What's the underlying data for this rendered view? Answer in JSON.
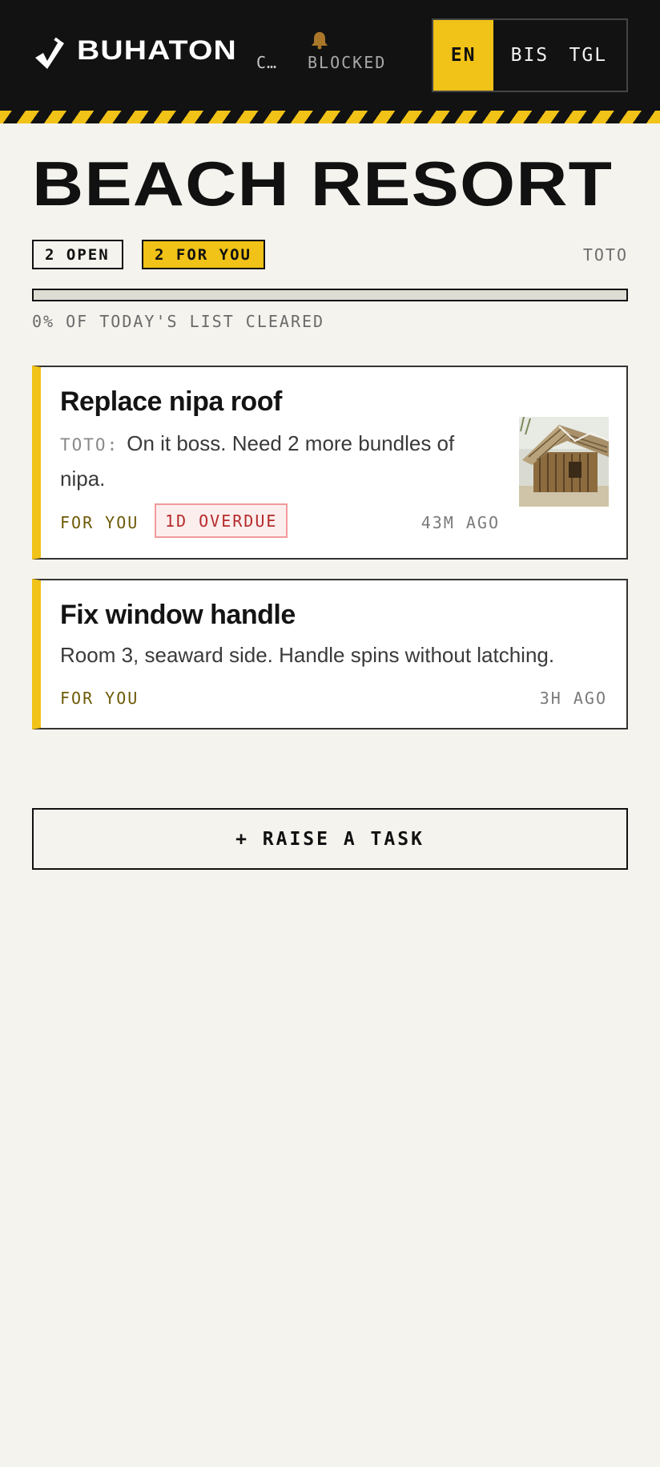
{
  "header": {
    "brand": "BUHATON",
    "site_truncated": "C…",
    "blocked_label": "BLOCKED",
    "languages": [
      "EN",
      "BIS",
      "TGL"
    ],
    "active_language": "EN"
  },
  "page": {
    "title": "BEACH RESORT",
    "open_chip": "2 OPEN",
    "foryou_chip": "2 FOR YOU",
    "current_user": "TOTO",
    "progress_percent": 0,
    "progress_text": "0% OF TODAY'S LIST CLEARED"
  },
  "tasks": [
    {
      "title": "Replace nipa roof",
      "comment_author": "TOTO:",
      "comment": "On it boss. Need 2 more bundles of nipa.",
      "tag": "FOR YOU",
      "overdue": "1D OVERDUE",
      "time": "43M AGO"
    },
    {
      "title": "Fix window handle",
      "description": "Room 3, seaward side. Handle spins without latching.",
      "tag": "FOR YOU",
      "time": "3H AGO"
    }
  ],
  "actions": {
    "raise_task": "+ RAISE A TASK"
  },
  "colors": {
    "accent": "#f1c217",
    "dark": "#121212",
    "background": "#f4f3ee",
    "overdue": "#b52a2a"
  },
  "icons": [
    "check-hammer-logo-icon",
    "bell-icon",
    "hut-thumbnail"
  ]
}
